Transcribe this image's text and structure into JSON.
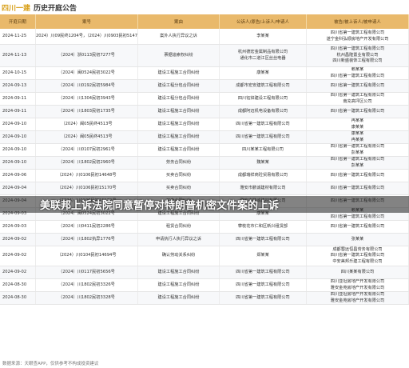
{
  "header": {
    "brand": "四川一建",
    "title": "历史开庭公告"
  },
  "columns": [
    "开庭日期",
    "案号",
    "案由",
    "公诉人/原告/上诉人/申请人",
    "被告/被上诉人/被申请人"
  ],
  "rows": [
    {
      "date": "2024-11-25",
      "case": [
        "（2024）川09民终1204号，（2024）川0903民初5147号"
      ],
      "cause": [
        "案外人执行异议之诉"
      ],
      "plaintiff": [
        "李某某"
      ],
      "defendant": [
        "四川省第一建筑工程有限公司",
        "遂宁金科弘顺房地产开发有限公司"
      ]
    },
    {
      "date": "2024-11-13",
      "case": [
        "（2024）浙0113民初7277号"
      ],
      "cause": [
        "票据追索权纠纷"
      ],
      "plaintiff": [
        "杭州德宏金属制品有限公司",
        "通化市二道江区丝丝电器"
      ],
      "defendant": [
        "四川省第一建筑工程有限公司",
        "杭州昌隆置业有限公司",
        "四川新盛装饰工程有限公司"
      ]
    },
    {
      "date": "2024-10-15",
      "case": [
        "（2024）闽0524民初3022号"
      ],
      "cause": [
        "建设工程施工合同纠纷"
      ],
      "plaintiff": [
        "康某某"
      ],
      "defendant": [
        "赖某某",
        "四川省第一建筑工程有限公司"
      ]
    },
    {
      "date": "2024-09-13",
      "case": [
        "（2024）川0192民初5984号"
      ],
      "cause": [
        "建设工程分包合同纠纷"
      ],
      "plaintiff": [
        "成都市宏安建筑工程有限公司"
      ],
      "defendant": [
        "四川省第一建筑工程有限公司"
      ]
    },
    {
      "date": "2024-09-11",
      "case": [
        "（2024）川1304民初3943号"
      ],
      "cause": [
        "建设工程分包合同纠纷"
      ],
      "plaintiff": [
        "四川钰锌建设工程有限公司"
      ],
      "defendant": [
        "四川省第一建筑工程有限公司",
        "南充高坪区公司"
      ]
    },
    {
      "date": "2024-09-11",
      "case": [
        "（2024）川1803民初1735号"
      ],
      "cause": [
        "建设工程施工合同纠纷"
      ],
      "plaintiff": [
        "成都阿迈机电设备有限公司"
      ],
      "defendant": [
        "四川省第一建筑工程有限公司"
      ]
    },
    {
      "date": "2024-09-10",
      "case": [
        "（2024）闽05民终4513号"
      ],
      "cause": [
        "建设工程施工合同纠纷"
      ],
      "plaintiff": [
        "四川省第一建筑工程有限公司"
      ],
      "defendant": [
        "冉某某",
        "康某某"
      ]
    },
    {
      "date": "2024-09-10",
      "case": [
        "（2024）闽05民终4513号"
      ],
      "cause": [
        "建设工程施工合同纠纷"
      ],
      "plaintiff": [
        "四川省第一建筑工程有限公司"
      ],
      "defendant": [
        "康某某",
        "冉某某"
      ]
    },
    {
      "date": "2024-09-10",
      "case": [
        "（2024）川0107民初2961号"
      ],
      "cause": [
        "建设工程施工合同纠纷"
      ],
      "plaintiff": [
        "四川某某工程有限公司"
      ],
      "defendant": [
        "四川省第一建筑工程有限公司",
        "彭某某"
      ]
    },
    {
      "date": "2024-09-10",
      "case": [
        "（2024）川1802民初2960号"
      ],
      "cause": [
        "劳务合同纠纷"
      ],
      "plaintiff": [
        "魏某某"
      ],
      "defendant": [
        "四川省第一建筑工程有限公司",
        "彭某某"
      ]
    },
    {
      "date": "2024-09-06",
      "case": [
        "（2024）川0106民初14648号"
      ],
      "cause": [
        "买卖合同纠纷"
      ],
      "plaintiff": [
        "成都瑞祥商砼贸易有限公司"
      ],
      "defendant": [
        "四川省第一建筑工程有限公司"
      ]
    },
    {
      "date": "2024-09-04",
      "case": [
        "（2024）川0106民初15170号"
      ],
      "cause": [
        "买卖合同纠纷"
      ],
      "plaintiff": [
        "雅安市鹏诚建材有限公司"
      ],
      "defendant": [
        "四川省第一建筑工程有限公司"
      ]
    },
    {
      "date": "2024-09-04",
      "case": [
        "（2024）川0106民初15172号"
      ],
      "cause": [
        "买卖合同纠纷"
      ],
      "plaintiff": [
        "雅安市鹏诚建材有限公司"
      ],
      "defendant": [
        "四川省第一建筑工程有限公司"
      ]
    },
    {
      "date": "2024-09-03",
      "case": [
        "（2024）闽0524民初3022号"
      ],
      "cause": [
        "建设工程施工合同纠纷"
      ],
      "plaintiff": [
        "康某某"
      ],
      "defendant": [
        "赖某某",
        "四川省第一建筑工程有限公司"
      ]
    },
    {
      "date": "2024-09-03",
      "case": [
        "（2024）川0411民初2286号"
      ],
      "cause": [
        "租赁合同纠纷"
      ],
      "plaintiff": [
        "攀枝花市仁和区新兴租赁部"
      ],
      "defendant": [
        "四川省第一建筑工程有限公司"
      ]
    },
    {
      "date": "2024-09-02",
      "case": [
        "（2024）川1802执异1776号"
      ],
      "cause": [
        "申请执行人执行异议之诉"
      ],
      "plaintiff": [
        "四川省第一建筑工程有限公司"
      ],
      "defendant": [
        "张某某"
      ]
    },
    {
      "date": "2024-09-02",
      "case": [
        "（2024）川0104民初14694号"
      ],
      "cause": [
        "确认劳动关系纠纷"
      ],
      "plaintiff": [
        "郑某某"
      ],
      "defendant": [
        "成都蜀远恒昌劳务有限公司",
        "四川省第一建筑工程有限公司",
        "中安美邦乐建工程有限公司"
      ]
    },
    {
      "date": "2024-09-02",
      "case": [
        "（2024）川0117民初5656号"
      ],
      "cause": [
        "建设工程施工合同纠纷"
      ],
      "plaintiff": [
        "四川省第一建筑工程有限公司"
      ],
      "defendant": [
        "四川某某有限公司"
      ]
    },
    {
      "date": "2024-08-30",
      "case": [
        "（2024）川1802民初3326号"
      ],
      "cause": [
        "建设工程施工合同纠纷"
      ],
      "plaintiff": [
        "四川省第一建筑工程有限公司"
      ],
      "defendant": [
        "四川亚坦房地产开发有限公司",
        "雅安金苑房地产开发有限公司"
      ]
    },
    {
      "date": "2024-08-30",
      "case": [
        "（2024）川1802民初3328号"
      ],
      "cause": [
        "建设工程施工合同纠纷"
      ],
      "plaintiff": [
        "四川省第一建筑工程有限公司"
      ],
      "defendant": [
        "四川亚坦房地产开发有限公司",
        "雅安金苑房地产开发有限公司"
      ]
    }
  ],
  "banner": "美联邦上诉法院同意暂停对特朗普机密文件案的上诉",
  "footer": "数据来源：天眼查APP，仅供参考不构成投资建议"
}
